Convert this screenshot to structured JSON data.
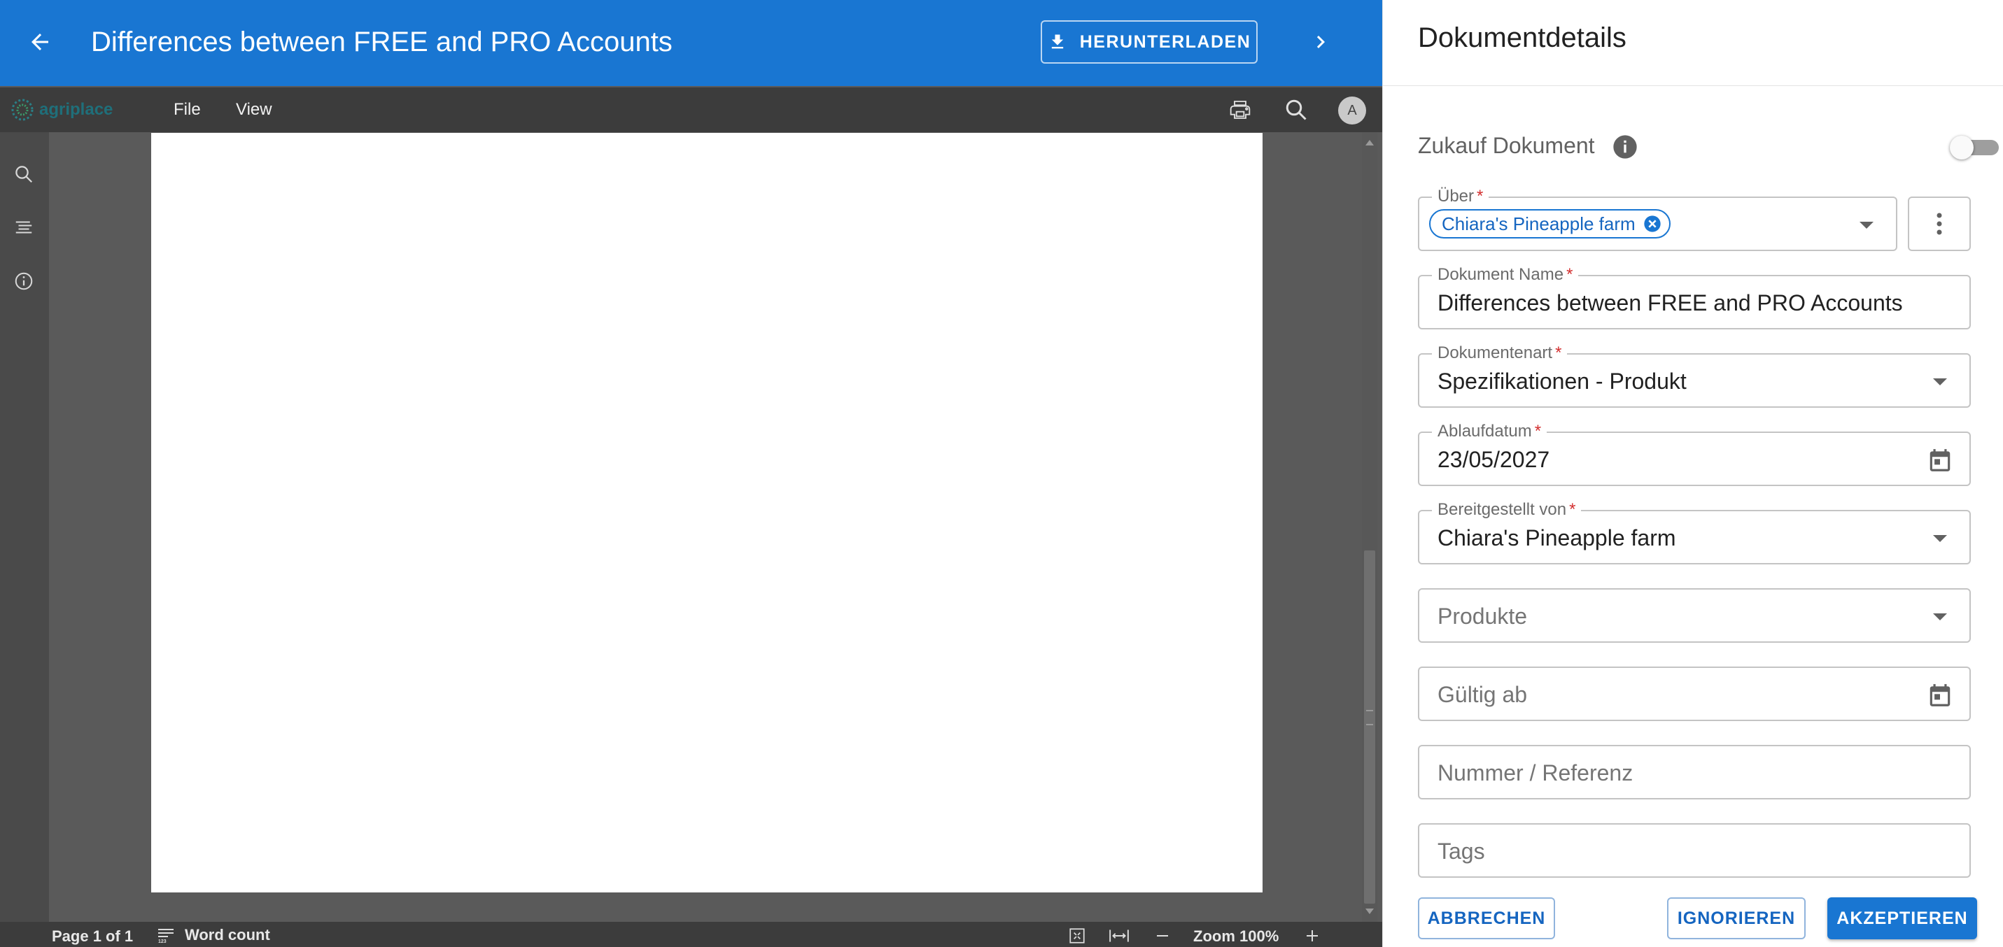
{
  "appbar": {
    "title": "Differences between FREE and PRO Accounts",
    "download_label": "HERUNTERLADEN",
    "back_icon": "arrow-left-icon",
    "next_icon": "chevron-right-icon"
  },
  "viewer": {
    "logo_text": "agriplace",
    "menu": [
      "File",
      "View"
    ],
    "status": {
      "page_info": "Page 1 of 1",
      "word_count": "Word count",
      "zoom": "Zoom 100%"
    },
    "colors": {
      "accent": "#1976d2",
      "toolbar": "#3c3c3c",
      "canvas_bg": "#5a5a5a"
    }
  },
  "details": {
    "title": "Dokumentdetails",
    "zukauf": {
      "label": "Zukauf Dokument",
      "enabled": false
    },
    "ueber": {
      "label": "Über",
      "chip": "Chiara's Pineapple farm"
    },
    "dokument_name": {
      "label": "Dokument Name",
      "value": "Differences between FREE and PRO Accounts"
    },
    "dokumentenart": {
      "label": "Dokumentenart",
      "value": "Spezifikationen - Produkt"
    },
    "ablaufdatum": {
      "label": "Ablaufdatum",
      "value": "23/05/2027"
    },
    "bereitgestellt": {
      "label": "Bereitgestellt von",
      "value": "Chiara's Pineapple farm"
    },
    "produkte": {
      "placeholder": "Produkte"
    },
    "gueltig_ab": {
      "placeholder": "Gültig ab"
    },
    "nummer": {
      "placeholder": "Nummer / Referenz"
    },
    "tags": {
      "placeholder": "Tags"
    },
    "buttons": {
      "cancel": "ABBRECHEN",
      "ignore": "IGNORIEREN",
      "accept": "AKZEPTIEREN"
    }
  }
}
